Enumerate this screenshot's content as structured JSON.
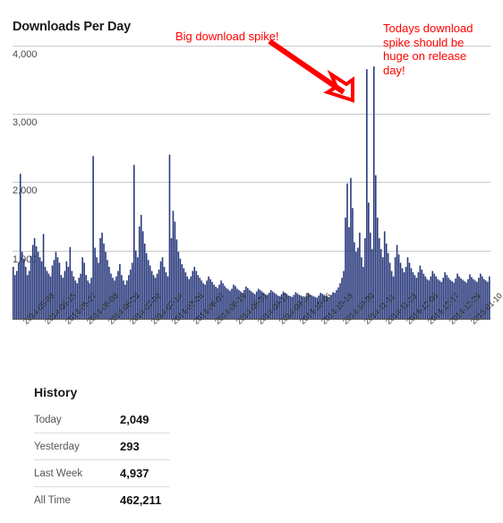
{
  "chart_panel": {
    "title": "Downloads Per Day",
    "annotations": [
      {
        "name": "big-spike-note",
        "text": "Big download spike!",
        "color": "#ff0000"
      },
      {
        "name": "todays-spike-note",
        "text": "Todays download\nspike should be\nhuge on release\nday!",
        "color": "#ff0000"
      }
    ]
  },
  "history": {
    "title": "History",
    "rows": [
      {
        "label": "Today",
        "value": "2,049"
      },
      {
        "label": "Yesterday",
        "value": "293"
      },
      {
        "label": "Last Week",
        "value": "4,937"
      },
      {
        "label": "All Time",
        "value": "462,211"
      }
    ]
  },
  "chart_data": {
    "type": "bar",
    "title": "Downloads Per Day",
    "xlabel": "",
    "ylabel": "",
    "ylim": [
      0,
      4400
    ],
    "xlim": [
      "2014-04-27",
      "2015-01-16"
    ],
    "grid": true,
    "legend": null,
    "bar_color": "#2a3a7c",
    "yticks": [
      1000,
      2000,
      3000,
      4000
    ],
    "ytick_labels": [
      "1,000",
      "2,000",
      "3,000",
      "4,000"
    ],
    "xtick_labels": [
      "2014-05-03",
      "2014-05-15",
      "2014-05-27",
      "2014-06-08",
      "2014-06-20",
      "2014-07-02",
      "2014-07-14",
      "2014-07-26",
      "2014-08-07",
      "2014-08-19",
      "2014-08-31",
      "2014-09-12",
      "2014-09-24",
      "2014-10-06",
      "2014-10-18",
      "2014-10-30",
      "2014-11-11",
      "2014-11-23",
      "2014-12-05",
      "2014-12-17",
      "2014-12-29",
      "2015-01-10"
    ],
    "xtick_indices": [
      6,
      18,
      30,
      42,
      54,
      66,
      78,
      90,
      102,
      114,
      126,
      138,
      150,
      162,
      174,
      186,
      198,
      210,
      222,
      234,
      246,
      258
    ],
    "n_points": 265,
    "values": [
      760,
      640,
      700,
      820,
      2120,
      980,
      880,
      760,
      640,
      700,
      920,
      1080,
      1180,
      1060,
      980,
      900,
      840,
      1240,
      760,
      700,
      660,
      620,
      780,
      860,
      980,
      900,
      820,
      640,
      600,
      700,
      840,
      760,
      1050,
      700,
      620,
      560,
      520,
      600,
      660,
      900,
      820,
      640,
      560,
      520,
      600,
      2380,
      1040,
      900,
      820,
      1180,
      1260,
      1100,
      980,
      860,
      760,
      660,
      600,
      560,
      620,
      700,
      800,
      640,
      560,
      500,
      560,
      640,
      720,
      820,
      2250,
      1000,
      900,
      1350,
      1520,
      1280,
      1100,
      960,
      860,
      780,
      700,
      640,
      600,
      660,
      720,
      840,
      900,
      760,
      680,
      620,
      2400,
      1180,
      1580,
      1420,
      1160,
      980,
      880,
      800,
      740,
      680,
      620,
      580,
      620,
      700,
      760,
      700,
      640,
      600,
      560,
      520,
      500,
      560,
      620,
      580,
      540,
      500,
      470,
      450,
      500,
      560,
      520,
      480,
      450,
      430,
      410,
      440,
      500,
      480,
      440,
      420,
      400,
      380,
      420,
      470,
      450,
      420,
      400,
      380,
      360,
      400,
      440,
      420,
      400,
      380,
      360,
      350,
      380,
      420,
      400,
      380,
      360,
      340,
      330,
      360,
      400,
      380,
      360,
      340,
      330,
      320,
      350,
      390,
      370,
      350,
      340,
      320,
      310,
      340,
      380,
      360,
      345,
      330,
      320,
      310,
      340,
      380,
      365,
      350,
      330,
      320,
      315,
      350,
      390,
      380,
      420,
      460,
      520,
      600,
      700,
      1480,
      1980,
      1340,
      2060,
      1620,
      1120,
      980,
      1040,
      1260,
      900,
      760,
      1180,
      3650,
      1700,
      1260,
      1020,
      3690,
      2100,
      1480,
      1180,
      1020,
      900,
      1280,
      1100,
      960,
      820,
      700,
      620,
      900,
      1080,
      940,
      820,
      740,
      680,
      760,
      900,
      820,
      740,
      680,
      640,
      600,
      680,
      780,
      720,
      660,
      620,
      580,
      560,
      620,
      700,
      660,
      620,
      580,
      560,
      540,
      600,
      680,
      640,
      600,
      570,
      550,
      530,
      590,
      660,
      620,
      590,
      570,
      550,
      530,
      580,
      650,
      610,
      580,
      560,
      540,
      600,
      660,
      620,
      580,
      560,
      540,
      620
    ]
  }
}
